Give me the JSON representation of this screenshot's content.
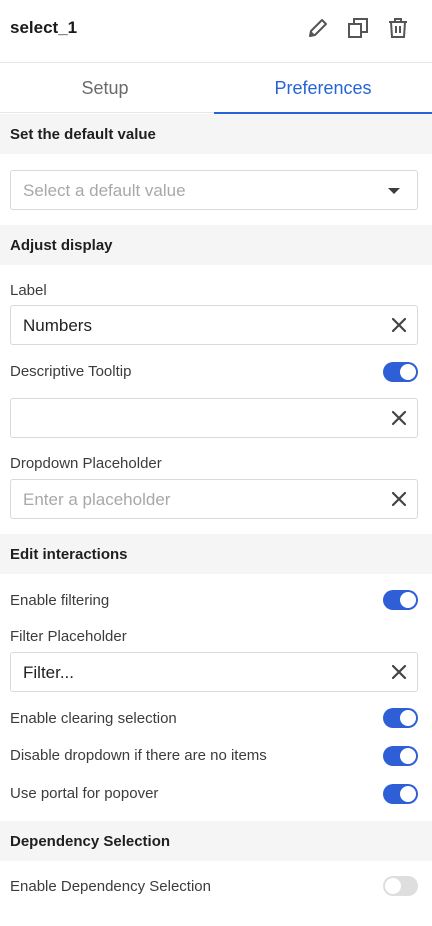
{
  "header": {
    "title": "select_1"
  },
  "tabs": [
    {
      "label": "Setup",
      "active": false
    },
    {
      "label": "Preferences",
      "active": true
    }
  ],
  "sections": {
    "default_value": "Set the default value",
    "adjust_display": "Adjust display",
    "edit_interactions": "Edit interactions",
    "dependency_selection": "Dependency Selection"
  },
  "default_value": {
    "placeholder": "Select a default value"
  },
  "label_field": {
    "label": "Label",
    "value": "Numbers"
  },
  "descriptive_tooltip": {
    "label": "Descriptive Tooltip",
    "enabled": true,
    "value": ""
  },
  "dropdown_placeholder": {
    "label": "Dropdown Placeholder",
    "placeholder": "Enter a placeholder"
  },
  "enable_filtering": {
    "label": "Enable filtering",
    "enabled": true
  },
  "filter_placeholder": {
    "label": "Filter Placeholder",
    "value": "Filter..."
  },
  "enable_clearing_selection": {
    "label": "Enable clearing selection",
    "enabled": true
  },
  "disable_dropdown_empty": {
    "label": "Disable dropdown if there are no items",
    "enabled": true
  },
  "use_portal_popover": {
    "label": "Use portal for popover",
    "enabled": true
  },
  "enable_dependency_selection": {
    "label": "Enable Dependency Selection",
    "enabled": false
  },
  "colors": {
    "accent": "#2563d8",
    "toggle_on": "#2f5fd6",
    "toggle_off": "#dedede"
  }
}
